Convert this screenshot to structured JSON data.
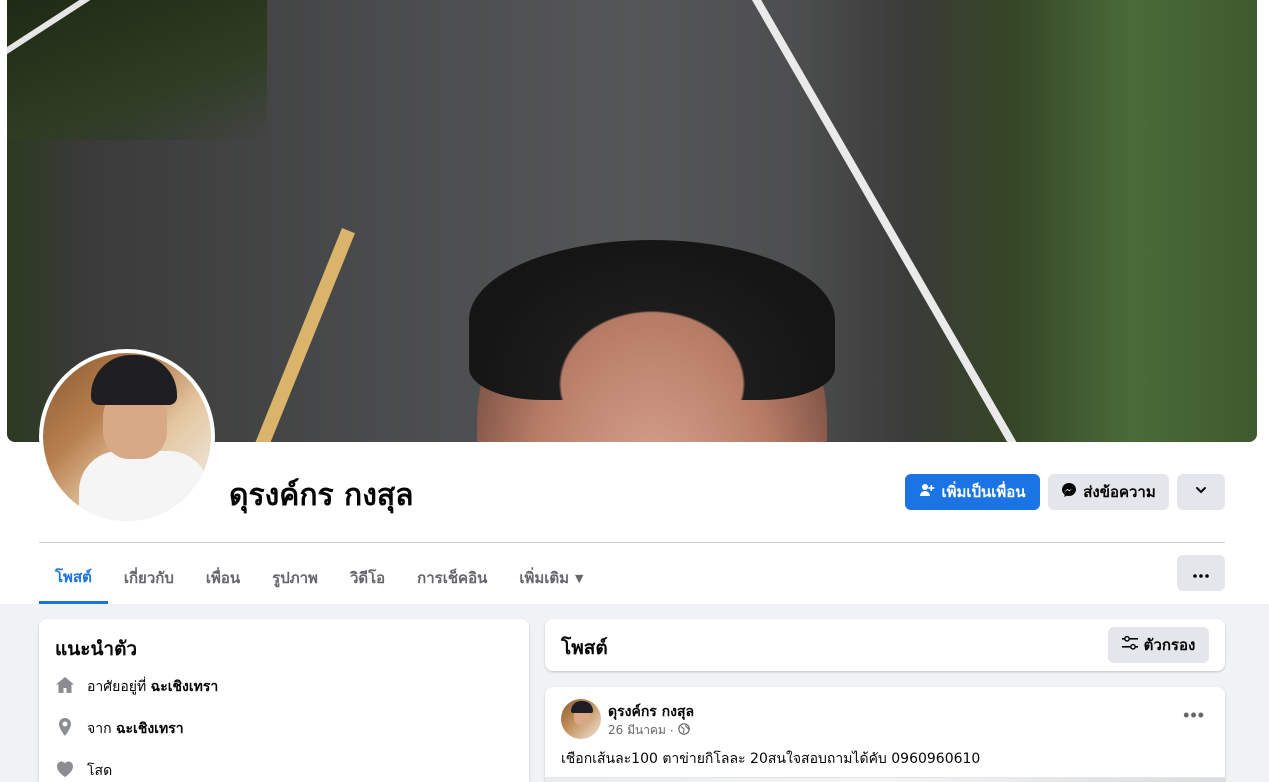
{
  "profile": {
    "name": "ดุรงค์กร กงสุล"
  },
  "actions": {
    "add_friend": "เพิ่มเป็นเพื่อน",
    "message": "ส่งข้อความ"
  },
  "tabs": [
    {
      "label": "โพสต์",
      "active": true
    },
    {
      "label": "เกี่ยวกับ"
    },
    {
      "label": "เพื่อน"
    },
    {
      "label": "รูปภาพ"
    },
    {
      "label": "วิดีโอ"
    },
    {
      "label": "การเช็คอิน"
    },
    {
      "label": "เพิ่มเติม"
    }
  ],
  "intro": {
    "title": "แนะนำตัว",
    "rows": [
      {
        "icon": "home-icon",
        "prefix": "อาศัยอยู่ที่",
        "value": "ฉะเชิงเทรา"
      },
      {
        "icon": "location-pin-icon",
        "prefix": "จาก",
        "value": "ฉะเชิงเทรา"
      },
      {
        "icon": "heart-icon",
        "prefix": "โสด",
        "value": ""
      }
    ]
  },
  "posts_section": {
    "title": "โพสต์",
    "filter_label": "ตัวกรอง"
  },
  "post": {
    "author": "ดุรงค์กร กงสุล",
    "date": "26 มีนาคม",
    "privacy": "globe-icon",
    "text": "เชือกเส้นละ100 ตาข่ายกิโลละ 20สนใจสอบถามได้คับ  0960960610"
  },
  "colors": {
    "accent": "#1b74e4",
    "secondary_button": "#e4e6eb",
    "page_background": "#f0f2f5",
    "muted_text": "#65676b"
  }
}
